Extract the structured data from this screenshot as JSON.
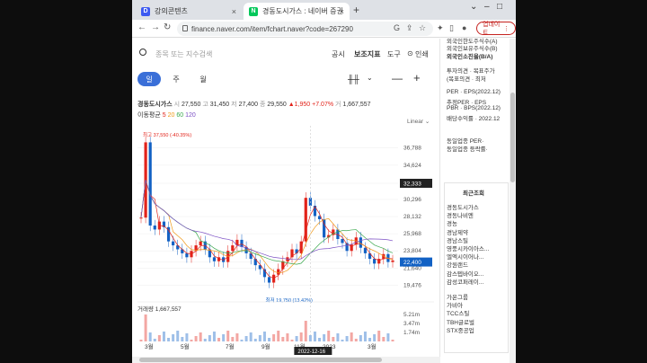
{
  "tabs": [
    {
      "label": "강의콘텐츠",
      "favicon": "D",
      "color": "#3d5af1"
    },
    {
      "label": "경동도시가스 : 네이버 증권",
      "favicon": "N",
      "color": "#03c75a"
    }
  ],
  "address": {
    "url": "finance.naver.com/item/fchart.naver?code=267290",
    "update_label": "업데이트"
  },
  "search": {
    "placeholder": "종목 또는 지수검색",
    "menu": [
      "공시",
      "보조지표",
      "도구",
      "인쇄"
    ]
  },
  "periods": [
    "일",
    "주",
    "월"
  ],
  "stock": {
    "name": "경동도시가스",
    "start_label": "시",
    "start": "27,550",
    "high_label": "고",
    "high": "31,450",
    "low_label": "저",
    "low": "27,400",
    "close_label": "종",
    "close": "29,550",
    "change": "▲1,950",
    "change_pct": "+7.07%",
    "volume_label": "거",
    "volume": "1,667,557",
    "ma_label": "이동평균",
    "ma": [
      "5",
      "20",
      "60",
      "120"
    ]
  },
  "chart_data": {
    "type": "line",
    "title": "",
    "scale": "Linear",
    "y_ticks": [
      "36,788",
      "34,624",
      "32,333",
      "30,296",
      "28,132",
      "25,968",
      "23,804",
      "22,400",
      "21,640",
      "19,476"
    ],
    "current_price_label": "32,333",
    "last_price_label": "22,400",
    "max_annotation": "최고 37,550 (-40.35%)",
    "min_annotation": "최저 19,750 (13.42%)",
    "volume_label": "거래량",
    "volume": "1,667,557",
    "volume_ticks": [
      "5.21m",
      "3.47m",
      "1.74m"
    ],
    "x_labels": [
      "3월",
      "5월",
      "7월",
      "9월",
      "11월",
      "2023",
      "3월"
    ],
    "crosshair_date": "2022-12-16",
    "series": [
      {
        "values": [
          28000,
          37500,
          27000,
          26500,
          27500,
          26800,
          25000,
          24500,
          24000,
          23500,
          23000,
          23800,
          24500,
          25000,
          24000,
          23000,
          22500,
          23000,
          22400,
          23800,
          24500,
          25200,
          24300,
          23500,
          22800,
          22000,
          21500,
          20500,
          19800,
          20800,
          21500,
          22500,
          23000,
          24000,
          23500,
          25000,
          30500,
          29500,
          28200,
          27800,
          25500,
          25800,
          26500,
          25300,
          24800,
          23800,
          24600,
          25500,
          24200,
          23500,
          22800,
          22200,
          22800,
          23400,
          22400,
          22600
        ]
      }
    ]
  },
  "sidebar": {
    "lines": [
      "외국인한도주식수(A)",
      "외국인보유주식수(B)",
      "외국인소진율(B/A)",
      "투자의견 · 목표주가",
      "(목표의견 · 최저",
      "PER · EPS(2022.12)",
      "추정PER · EPS",
      "PBR · BPS(2022.12)",
      "배당수익률 · 2022.12",
      "동일업종 PER·",
      "동일업종 등락률·"
    ],
    "recent_title": "최근조회",
    "recent": [
      "경동도시가스",
      "경동나비엔",
      "경농",
      "경남제약",
      "경남스틸",
      "영풍시카이아스...",
      "엘엑시이어나...",
      "강원랜드",
      "감스텝바이오...",
      "감성코퍼레이...",
      "가온그룹",
      "가비아",
      "TCC스틸",
      "TBH글로벌",
      "STX중공업"
    ]
  },
  "colors": {
    "up": "#e2231a",
    "down": "#1261c4",
    "accent": "#3a6fd8"
  }
}
